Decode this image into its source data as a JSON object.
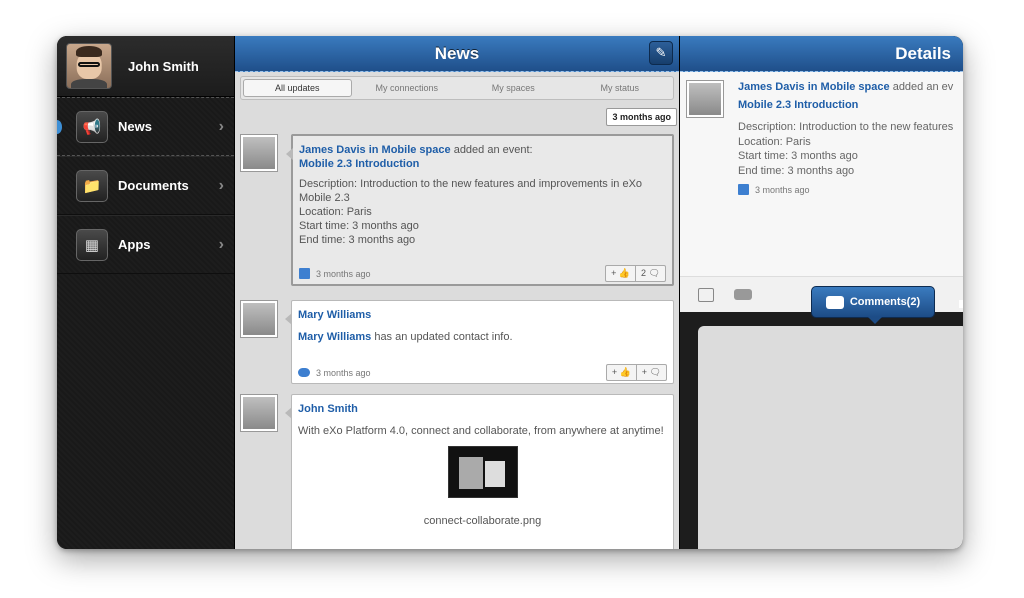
{
  "sidebar": {
    "user_name": "John Smith",
    "items": [
      {
        "label": "News",
        "icon": "megaphone-icon"
      },
      {
        "label": "Documents",
        "icon": "folder-icon"
      },
      {
        "label": "Apps",
        "icon": "apps-grid-icon"
      }
    ]
  },
  "news": {
    "title": "News",
    "tabs": [
      "All updates",
      "My connections",
      "My spaces",
      "My status"
    ],
    "time_badge": "3 months ago",
    "posts": [
      {
        "author": "James Davis in Mobile space",
        "action": " added an event:",
        "event_title": "Mobile 2.3 Introduction",
        "description": "Description: Introduction to the new features and improvements in eXo Mobile 2.3",
        "location": "Location: Paris",
        "start": "Start time: 3 months ago",
        "end": "End time: 3 months ago",
        "time": "3 months ago",
        "like_label": "+",
        "comment_label": "2"
      },
      {
        "author": "Mary Williams",
        "author_inline": "Mary Williams",
        "text": " has an updated contact info.",
        "time": "3 months ago",
        "like_label": "+",
        "comment_label": "+"
      },
      {
        "author": "John Smith",
        "text": "With eXo Platform 4.0, connect and collaborate, from anywhere at anytime!",
        "attachment": "connect-collaborate.png"
      }
    ]
  },
  "details": {
    "title": "Details",
    "author": "James Davis in Mobile space",
    "action": " added an ev",
    "event_title": "Mobile 2.3 Introduction",
    "description": "Description: Introduction to the new features",
    "location": "Location: Paris",
    "start": "Start time: 3 months ago",
    "end": "End time: 3 months ago",
    "time": "3 months ago",
    "comments_button": "Comments(2)"
  }
}
